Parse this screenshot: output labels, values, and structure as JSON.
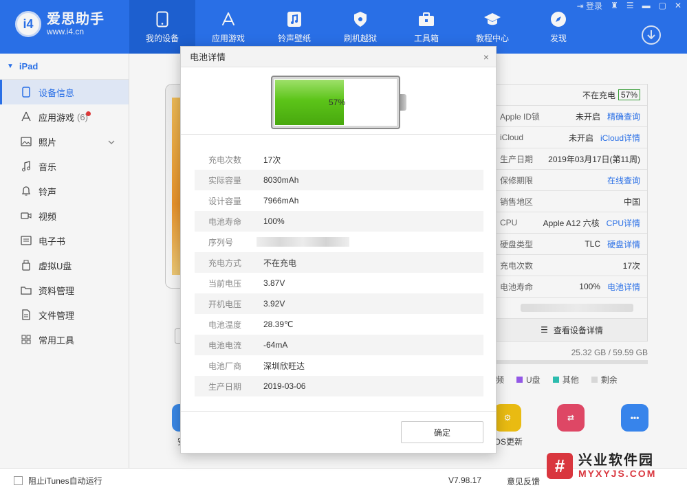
{
  "app": {
    "logo_badge": "i4",
    "logo_title": "爱思助手",
    "logo_url": "www.i4.cn",
    "login_label": "登录"
  },
  "nav": [
    {
      "label": "我的设备",
      "icon": "phone-icon",
      "active": true
    },
    {
      "label": "应用游戏",
      "icon": "appstore-icon"
    },
    {
      "label": "铃声壁纸",
      "icon": "music-file-icon"
    },
    {
      "label": "刷机越狱",
      "icon": "shield-icon"
    },
    {
      "label": "工具箱",
      "icon": "toolbox-icon"
    },
    {
      "label": "教程中心",
      "icon": "graduation-cap-icon"
    },
    {
      "label": "发现",
      "icon": "compass-icon"
    }
  ],
  "sidebar": {
    "device": "iPad",
    "items": [
      {
        "label": "设备信息",
        "icon": "tablet-icon",
        "active": true
      },
      {
        "label": "应用游戏",
        "icon": "apps-icon",
        "count": "(6)",
        "dot": true
      },
      {
        "label": "照片",
        "icon": "photo-icon",
        "chevron": true
      },
      {
        "label": "音乐",
        "icon": "music-note-icon"
      },
      {
        "label": "铃声",
        "icon": "bell-icon"
      },
      {
        "label": "视频",
        "icon": "video-icon"
      },
      {
        "label": "电子书",
        "icon": "book-icon"
      },
      {
        "label": "虚拟U盘",
        "icon": "usb-icon"
      },
      {
        "label": "资料管理",
        "icon": "folder-icon"
      },
      {
        "label": "文件管理",
        "icon": "file-icon"
      },
      {
        "label": "常用工具",
        "icon": "grid-icon"
      }
    ]
  },
  "device_info": {
    "charging_status": "不在充电",
    "charging_pct": "57%",
    "rows": [
      {
        "key": "Apple ID锁",
        "value": "未开启",
        "link": "精确查询"
      },
      {
        "key": "iCloud",
        "value": "未开启",
        "link": "iCloud详情"
      },
      {
        "key": "生产日期",
        "value": "2019年03月17日(第11周)",
        "link": ""
      },
      {
        "key": "保修期限",
        "value": "",
        "link": "在线查询"
      },
      {
        "key": "销售地区",
        "value": "中国",
        "link": ""
      },
      {
        "key": "CPU",
        "value": "Apple A12 六核",
        "link": "CPU详情"
      },
      {
        "key": "硬盘类型",
        "value": "TLC",
        "link": "硬盘详情"
      },
      {
        "key": "充电次数",
        "value": "17次",
        "link": ""
      },
      {
        "key": "电池寿命",
        "value": "100%",
        "link": "电池详情"
      }
    ],
    "view_details": "查看设备详情",
    "storage": "25.32 GB / 59.59 GB",
    "legend": [
      {
        "label": "频",
        "color": "#f0a030"
      },
      {
        "label": "U盘",
        "color": "#9a5cf0"
      },
      {
        "label": "其他",
        "color": "#2ec4b6"
      },
      {
        "label": "剩余",
        "color": "#e0e0e0"
      }
    ]
  },
  "bottom_apps": [
    {
      "label": "安装",
      "color": "#3d8ef0",
      "glyph": "▶"
    },
    {
      "label": "iOS更新",
      "color": "#f3c313",
      "glyph": "⚙"
    },
    {
      "label": "",
      "color": "#e84a6a",
      "glyph": "⇄"
    },
    {
      "label": "",
      "color": "#3a8af5",
      "glyph": "•••"
    }
  ],
  "status": {
    "itunes_label": "阻止iTunes自动运行",
    "version": "V7.98.17",
    "feedback": "意见反馈"
  },
  "watermark": {
    "logo": "#",
    "cn": "兴业软件园",
    "en": "MYXYJS.COM"
  },
  "dialog": {
    "title": "电池详情",
    "close": "×",
    "battery_pct_label": "57%",
    "battery_level": 0.57,
    "rows": [
      {
        "key": "充电次数",
        "value": "17次"
      },
      {
        "key": "实际容量",
        "value": "8030mAh"
      },
      {
        "key": "设计容量",
        "value": "7966mAh"
      },
      {
        "key": "电池寿命",
        "value": "100%"
      },
      {
        "key": "序列号",
        "value": ""
      },
      {
        "key": "充电方式",
        "value": "不在充电"
      },
      {
        "key": "当前电压",
        "value": "3.87V"
      },
      {
        "key": "开机电压",
        "value": "3.92V"
      },
      {
        "key": "电池温度",
        "value": "28.39℃"
      },
      {
        "key": "电池电流",
        "value": "-64mA"
      },
      {
        "key": "电池厂商",
        "value": "深圳欣旺达"
      },
      {
        "key": "生产日期",
        "value": "2019-03-06"
      }
    ],
    "ok_label": "确定"
  }
}
